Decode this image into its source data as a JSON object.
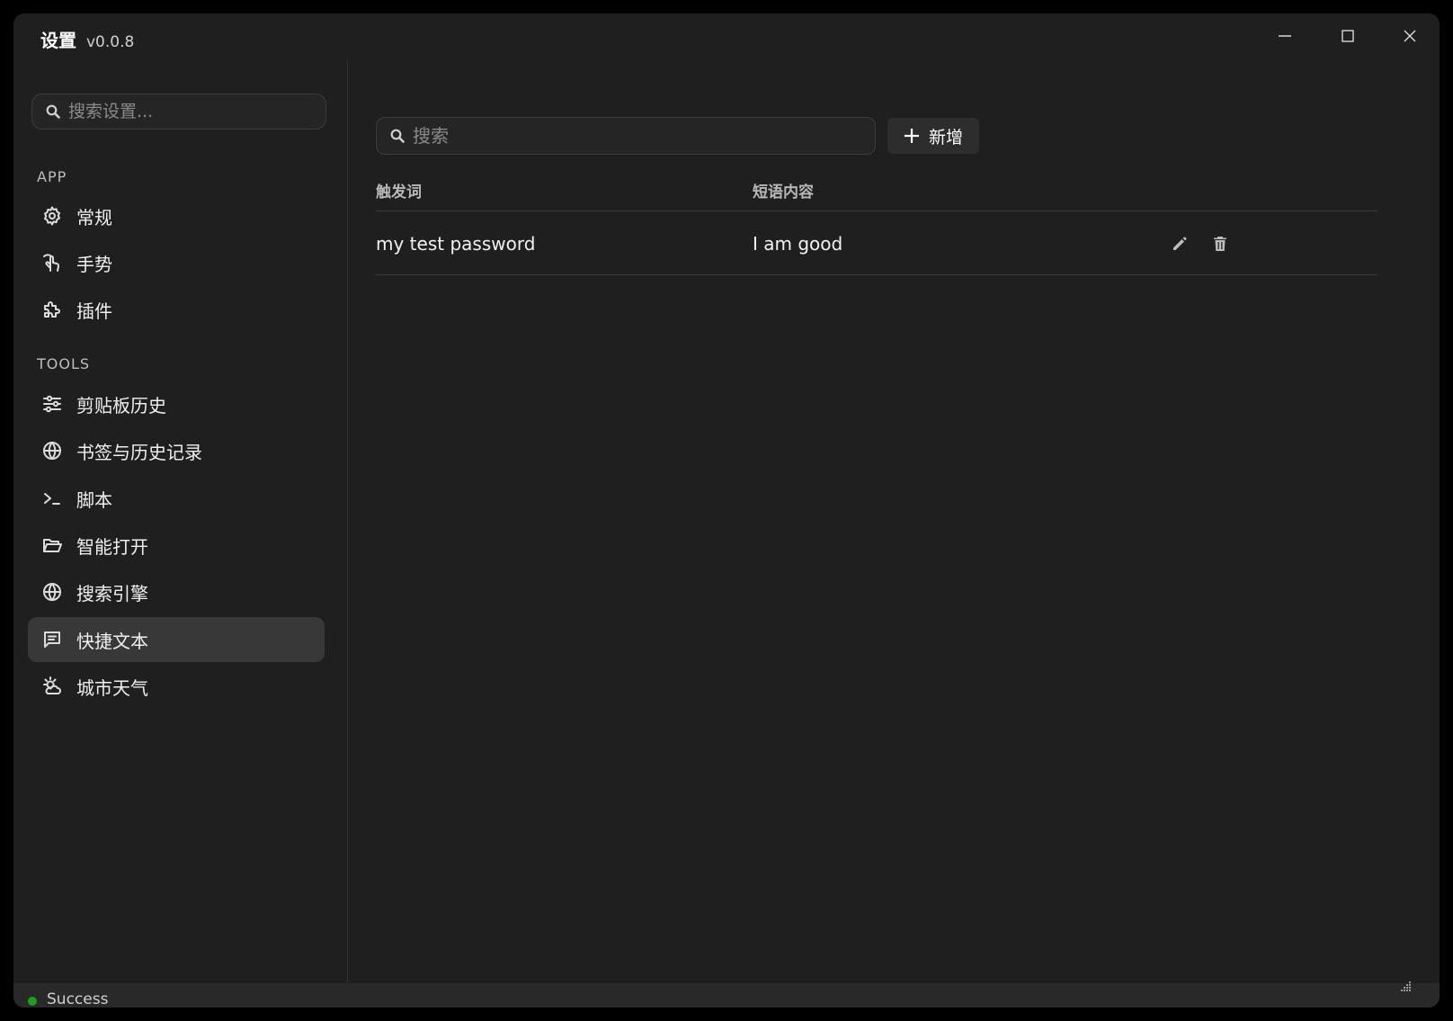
{
  "window": {
    "title": "设置",
    "version": "v0.0.8"
  },
  "sidebar": {
    "search_placeholder": "搜索设置...",
    "sections": [
      {
        "label": "APP"
      },
      {
        "label": "TOOLS"
      }
    ],
    "items": [
      {
        "label": "常规",
        "icon": "gear-icon"
      },
      {
        "label": "手势",
        "icon": "hand-pointer-icon"
      },
      {
        "label": "插件",
        "icon": "puzzle-icon"
      },
      {
        "label": "剪贴板历史",
        "icon": "sliders-icon"
      },
      {
        "label": "书签与历史记录",
        "icon": "globe-icon"
      },
      {
        "label": "脚本",
        "icon": "terminal-icon"
      },
      {
        "label": "智能打开",
        "icon": "folder-open-icon"
      },
      {
        "label": "搜索引擎",
        "icon": "globe-icon"
      },
      {
        "label": "快捷文本",
        "icon": "message-icon",
        "active": true
      },
      {
        "label": "城市天气",
        "icon": "weather-icon"
      }
    ]
  },
  "main": {
    "search_placeholder": "搜索",
    "add_label": "新增",
    "columns": [
      "触发词",
      "短语内容"
    ],
    "rows": [
      {
        "trigger": "my test password",
        "content": "I am good"
      }
    ]
  },
  "status": {
    "text": "Success",
    "color": "#1aa31a"
  }
}
